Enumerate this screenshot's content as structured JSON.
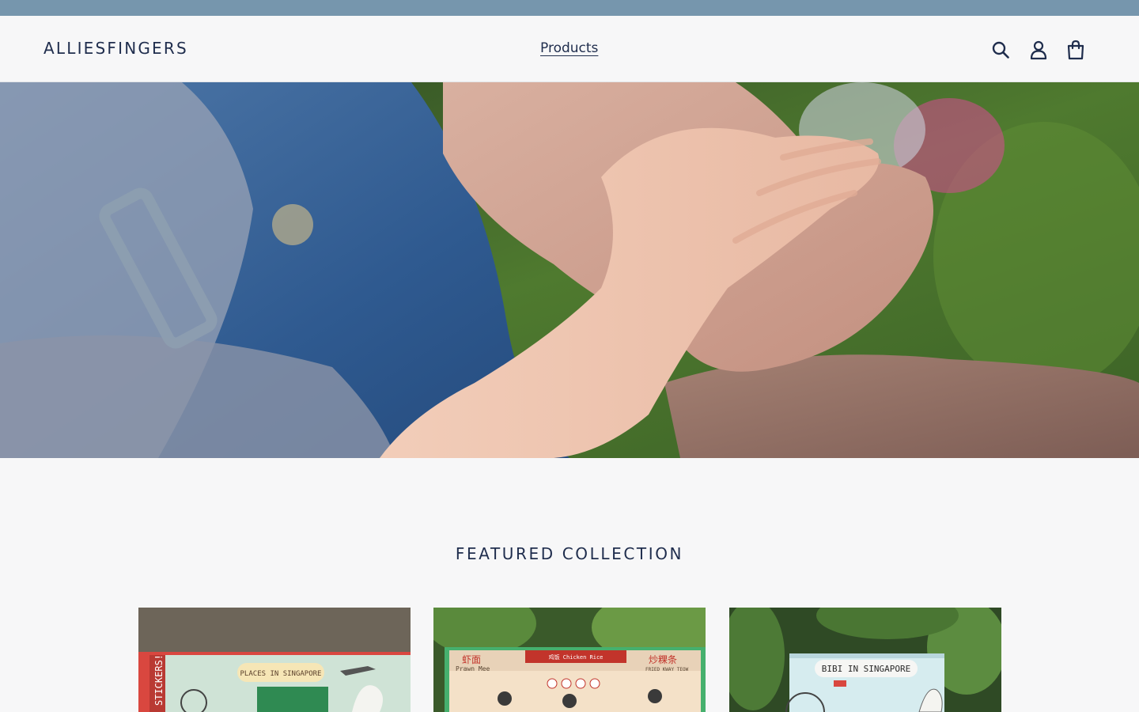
{
  "store": {
    "logo_text": "ALLIESFINGERS"
  },
  "nav": {
    "products_label": "Products"
  },
  "header_icons": [
    "search-icon",
    "account-icon",
    "cart-icon"
  ],
  "colors": {
    "announcement_bar": "#7696ad",
    "text": "#1f2d4d",
    "background": "#f7f7f8"
  },
  "featured": {
    "title": "FEATURED COLLECTION",
    "products": [
      {
        "banner": "PLACES IN SINGAPORE",
        "side_text": "STICKERS!"
      },
      {
        "labels": [
          "虾面",
          "Prawn Mee",
          "鸡饭 Chicken Rice",
          "炒粿条",
          "FRIED KWAY TEOW"
        ]
      },
      {
        "title": "BIBI IN SINGAPORE"
      }
    ]
  }
}
